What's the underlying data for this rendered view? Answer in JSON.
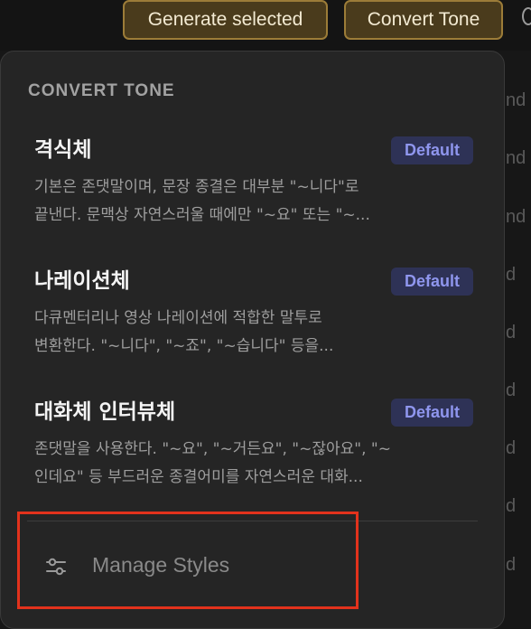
{
  "toolbar": {
    "generate_label": "Generate selected",
    "convert_label": "Convert Tone"
  },
  "background_fragments": [
    "nd",
    "nd",
    "nd",
    "d",
    "d",
    "d",
    "d",
    "d",
    "d",
    "d"
  ],
  "menu": {
    "heading": "CONVERT TONE",
    "items": [
      {
        "title": "격식체",
        "badge": "Default",
        "desc_line1": "기본은 존댓말이며, 문장 종결은 대부분 \"~니다\"로",
        "desc_line2": "끝낸다. 문맥상 자연스러울 때에만 \"~요\" 또는 \"~..."
      },
      {
        "title": "나레이션체",
        "badge": "Default",
        "desc_line1": "다큐멘터리나 영상 나레이션에 적합한 말투로",
        "desc_line2": "변환한다. \"~니다\", \"~죠\", \"~습니다\" 등을..."
      },
      {
        "title": "대화체 인터뷰체",
        "badge": "Default",
        "desc_line1": "존댓말을 사용한다. \"~요\", \"~거든요\", \"~잖아요\", \"~",
        "desc_line2": "인데요\" 등 부드러운 종결어미를 자연스러운 대화..."
      }
    ],
    "manage_label": "Manage Styles",
    "manage_icon": "sliders-icon"
  },
  "colors": {
    "accent_button_bg": "#4a3b1c",
    "accent_button_border": "#9c7c38",
    "badge_bg": "#2e3256",
    "badge_text": "#8f96ee",
    "highlight": "#e2321c"
  }
}
